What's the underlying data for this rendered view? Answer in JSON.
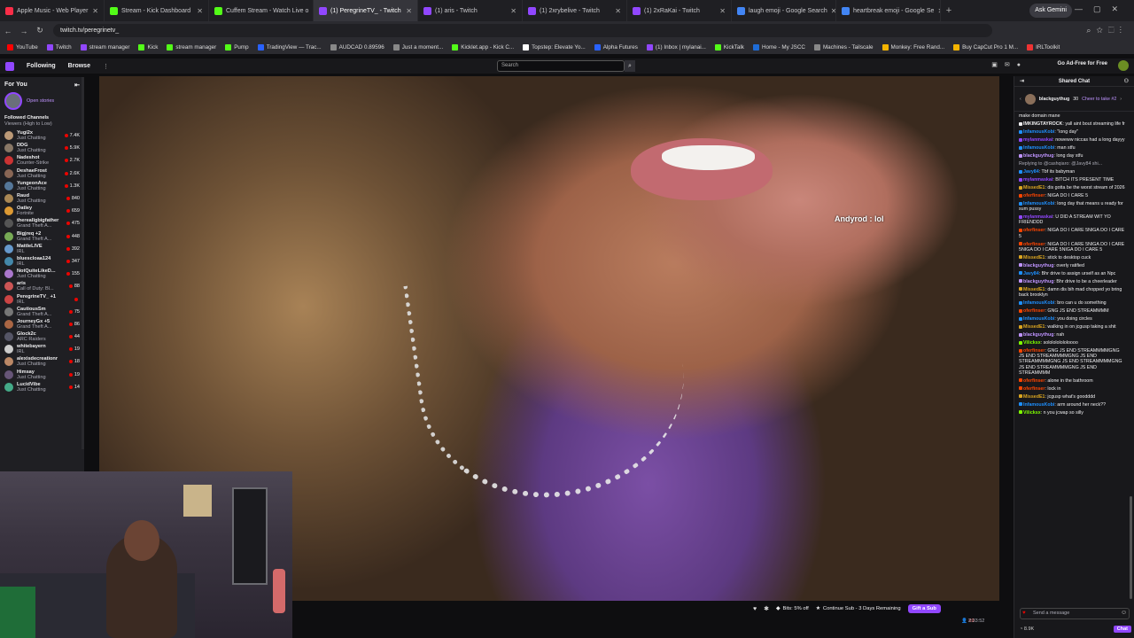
{
  "browser": {
    "tabs": [
      {
        "title": "Apple Music - Web Player",
        "color": "#fa2d48",
        "active": false
      },
      {
        "title": "Stream - Kick Dashboard",
        "color": "#53fc18",
        "active": false
      },
      {
        "title": "Cuffem Stream - Watch Live o",
        "color": "#53fc18",
        "active": false
      },
      {
        "title": "(1) PeregrineTV_ - Twitch",
        "color": "#9147ff",
        "active": true
      },
      {
        "title": "(1) aris - Twitch",
        "color": "#9147ff",
        "active": false
      },
      {
        "title": "(1) 2xrybelive - Twitch",
        "color": "#9147ff",
        "active": false
      },
      {
        "title": "(1) 2xRaKai - Twitch",
        "color": "#9147ff",
        "active": false
      },
      {
        "title": "laugh emoji - Google Search",
        "color": "#4285f4",
        "active": false
      },
      {
        "title": "heartbreak emoji - Google Se",
        "color": "#4285f4",
        "active": false
      }
    ],
    "new_tab": "+",
    "gemini": "Ask Gemini",
    "url": "twitch.tv/peregrinetv_",
    "bookmarks": [
      {
        "label": "YouTube",
        "color": "#ff0000"
      },
      {
        "label": "Twitch",
        "color": "#9147ff"
      },
      {
        "label": "stream manager",
        "color": "#9147ff"
      },
      {
        "label": "Kick",
        "color": "#53fc18"
      },
      {
        "label": "stream manager",
        "color": "#53fc18"
      },
      {
        "label": "Pump",
        "color": "#53fc18"
      },
      {
        "label": "TradingView — Trac...",
        "color": "#2962ff"
      },
      {
        "label": "AUDCAD 0.89596",
        "color": "#888888"
      },
      {
        "label": "Just a moment...",
        "color": "#888888"
      },
      {
        "label": "Kicklet.app - Kick C...",
        "color": "#53fc18"
      },
      {
        "label": "Topstep: Elevate Yo...",
        "color": "#ffffff"
      },
      {
        "label": "Alpha Futures",
        "color": "#2962ff"
      },
      {
        "label": "(1) Inbox | mylanai...",
        "color": "#9147ff"
      },
      {
        "label": "KickTalk",
        "color": "#53fc18"
      },
      {
        "label": "Home - My JSCC",
        "color": "#1e6cd6"
      },
      {
        "label": "Machines - Tailscale",
        "color": "#888888"
      },
      {
        "label": "Monkey: Free Rand...",
        "color": "#f4b400"
      },
      {
        "label": "Buy CapCut Pro 1 M...",
        "color": "#f4b400"
      },
      {
        "label": "IRLToolkit",
        "color": "#e33"
      }
    ]
  },
  "twitch_nav": {
    "following": "Following",
    "browse": "Browse",
    "more": "⋮",
    "search_placeholder": "Search",
    "ad_free": "Go Ad-Free for Free"
  },
  "sidebar": {
    "for_you": "For You",
    "open_stories": "Open stories",
    "followed_title": "Followed Channels",
    "followed_sort": "Viewers (High to Low)",
    "channels": [
      {
        "name": "Yugi2x",
        "game": "Just Chatting",
        "viewers": "7.4K",
        "color": "#b97"
      },
      {
        "name": "DDG",
        "game": "Just Chatting",
        "viewers": "5.9K",
        "color": "#876"
      },
      {
        "name": "Nadeshot",
        "game": "Counter-Strike",
        "viewers": "2.7K",
        "color": "#c33"
      },
      {
        "name": "DeshaeFrost",
        "game": "Just Chatting",
        "viewers": "2.6K",
        "color": "#865"
      },
      {
        "name": "YungeonAce",
        "game": "Just Chatting",
        "viewers": "1.3K",
        "color": "#579"
      },
      {
        "name": "Raud",
        "game": "Just Chatting",
        "viewers": "840",
        "color": "#a85"
      },
      {
        "name": "Oatley",
        "game": "Fortnite",
        "viewers": "659",
        "color": "#d93"
      },
      {
        "name": "thereallgbigfather",
        "game": "Grand Theft A...",
        "viewers": "475",
        "color": "#555"
      },
      {
        "name": "Bigjreq +2",
        "game": "Grand Theft A...",
        "viewers": "448",
        "color": "#7a5"
      },
      {
        "name": "MattleLIVE",
        "game": "IRL",
        "viewers": "392",
        "color": "#69c"
      },
      {
        "name": "bluescloaa124",
        "game": "IRL",
        "viewers": "347",
        "color": "#48a"
      },
      {
        "name": "NotQuiteLikeD...",
        "game": "Just Chatting",
        "viewers": "155",
        "color": "#a7c"
      },
      {
        "name": "aris",
        "game": "Call of Duty: Bl...",
        "viewers": "88",
        "color": "#c55"
      },
      {
        "name": "PeregrineTV_ +1",
        "game": "IRL",
        "viewers": "",
        "color": "#c44"
      },
      {
        "name": "CautiousSm",
        "game": "Grand Theft A...",
        "viewers": "75",
        "color": "#777"
      },
      {
        "name": "JourneyGx +5",
        "game": "Grand Theft A...",
        "viewers": "86",
        "color": "#a64"
      },
      {
        "name": "Glock2c",
        "game": "ARC Raiders",
        "viewers": "44",
        "color": "#556"
      },
      {
        "name": "whitebayern",
        "game": "IRL",
        "viewers": "19",
        "color": "#ccc"
      },
      {
        "name": "alexisdecreationr",
        "game": "Just Chatting",
        "viewers": "18",
        "color": "#b86"
      },
      {
        "name": "Himsay",
        "game": "Just Chatting",
        "viewers": "19",
        "color": "#657"
      },
      {
        "name": "LucidVibe",
        "game": "Just Chatting",
        "viewers": "14",
        "color": "#4a8"
      }
    ]
  },
  "video": {
    "overlay_text": "Andyrod : lol"
  },
  "controls": {
    "bits": "Bits: 5% off",
    "continue_sub": "Continue Sub - 3 Days Remaining",
    "gift_sub": "Gift a Sub",
    "viewers": "89",
    "uptime": "2:33:52"
  },
  "chat": {
    "header": "Shared Chat",
    "hype_user": "blackguythug",
    "hype_count": "30",
    "hype_label": "Cheer to take #2",
    "messages": [
      {
        "user": "",
        "color": "#efeff1",
        "text": "make domain mane"
      },
      {
        "user": "IMKINGTAYROCK",
        "color": "#efeff1",
        "text": "yall aint bout streaming life fr"
      },
      {
        "user": "InfamousKobi",
        "color": "#1e90ff",
        "text": "\"long day\""
      },
      {
        "user": "mylanmaskai",
        "color": "#9147ff",
        "text": "noweww niccas had a long dayyy"
      },
      {
        "user": "InfamousKobi",
        "color": "#1e90ff",
        "text": "man stfu"
      },
      {
        "user": "blackguythug",
        "color": "#bf94ff",
        "text": "long day stfu"
      },
      {
        "user": "",
        "color": "#adadb8",
        "text": "Replying to @cashqiaro: @Javy84 shi..."
      },
      {
        "user": "Javy84",
        "color": "#1e90ff",
        "text": "Tbf its babyman"
      },
      {
        "user": "mylanmaskai",
        "color": "#9147ff",
        "text": "BITCH ITS PRESENT TIME"
      },
      {
        "user": "MissedE1",
        "color": "#daa520",
        "text": "dis gotta be the worst stream of 2026"
      },
      {
        "user": "oferfinser",
        "color": "#ff4500",
        "text": "NIGA DO I CARE 5"
      },
      {
        "user": "InfamousKobi",
        "color": "#1e90ff",
        "text": "long day that means u ready for sum pussy"
      },
      {
        "user": "mylanmaskai",
        "color": "#9147ff",
        "text": "U DID A STREAM WIT YO FRIENDDD"
      },
      {
        "user": "oferfinser",
        "color": "#ff4500",
        "text": "NIGA DO I CARE 5NIGA DO I CARE 5"
      },
      {
        "user": "oferfinser",
        "color": "#ff4500",
        "text": "NIGA DO I CARE 5NIGA DO I CARE 5NIGA DO I CARE 5NIGA DO I CARE 5"
      },
      {
        "user": "MissedE1",
        "color": "#daa520",
        "text": "stick to desktop cuck"
      },
      {
        "user": "blackguythug",
        "color": "#bf94ff",
        "text": "overly ratified"
      },
      {
        "user": "Javy84",
        "color": "#1e90ff",
        "text": "Bhr drive to assign urself as an Npc"
      },
      {
        "user": "blackguythug",
        "color": "#bf94ff",
        "text": "Bhr drive to be a cheerleader"
      },
      {
        "user": "MissedE1",
        "color": "#daa520",
        "text": "damn dis bih mad chopped yo bring back brooklyn"
      },
      {
        "user": "InfamousKobi",
        "color": "#1e90ff",
        "text": "bro can u do something"
      },
      {
        "user": "oferfinser",
        "color": "#ff4500",
        "text": "GNG JS END STREAMMMM"
      },
      {
        "user": "InfamousKobi",
        "color": "#1e90ff",
        "text": "you doing circles"
      },
      {
        "user": "MissedE1",
        "color": "#daa520",
        "text": "walking in on jcgusp taking a shit"
      },
      {
        "user": "blackguythug",
        "color": "#bf94ff",
        "text": "nah"
      },
      {
        "user": "Vilicksx",
        "color": "#7fff00",
        "text": "sololololololoooo"
      },
      {
        "user": "oferfinser",
        "color": "#ff4500",
        "text": "GNG JS END STREAMMMMGNG JS END STREAMMMMGNG JS END STREAMMMMGNG JS END STREAMMMMGNG JS END STREAMMMMGNG JS END STREAMMMM"
      },
      {
        "user": "oferfinser",
        "color": "#ff4500",
        "text": "alone in the bathroom"
      },
      {
        "user": "oferfinser",
        "color": "#ff4500",
        "text": "lock in"
      },
      {
        "user": "MissedE1",
        "color": "#daa520",
        "text": "jcgusp what's goodddd"
      },
      {
        "user": "InfamousKobi",
        "color": "#1e90ff",
        "text": "arm around her neck??"
      },
      {
        "user": "Vilicksx",
        "color": "#7fff00",
        "text": "n you jcwap so silly"
      }
    ],
    "input_placeholder": "Send a message",
    "points": "8.9K",
    "chat_button": "Chat"
  }
}
